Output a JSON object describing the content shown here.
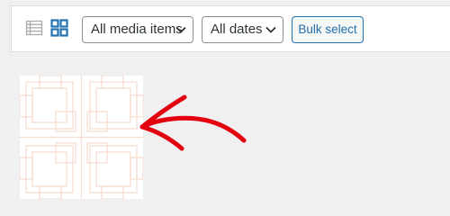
{
  "toolbar": {
    "view_modes": [
      {
        "name": "list-view",
        "icon": "list-icon",
        "active": false
      },
      {
        "name": "grid-view",
        "icon": "grid-icon",
        "active": true
      }
    ],
    "media_filter": {
      "selected": "All media items"
    },
    "date_filter": {
      "selected": "All dates"
    },
    "bulk_select_label": "Bulk select"
  },
  "media": {
    "items": [
      {
        "type": "image",
        "description": "geometric pattern thumbnail"
      }
    ]
  },
  "annotation": {
    "icon": "red-hand-drawn-arrow",
    "color": "#e3000f"
  },
  "colors": {
    "accent": "#2271b1",
    "background": "#f0f0f1",
    "pattern_stroke": "#f6ddd0"
  }
}
